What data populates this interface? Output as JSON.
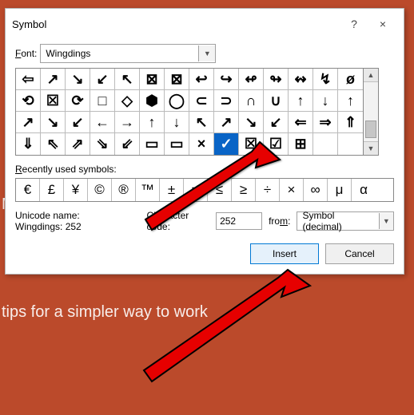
{
  "background": {
    "line1": "M",
    "line2": "tips for a simpler way to work"
  },
  "dialog": {
    "title": "Symbol",
    "help_icon": "?",
    "close_icon": "×",
    "font_label": "Font:",
    "font_value": "Wingdings",
    "grid_rows": [
      [
        "⇦",
        "↗",
        "↘",
        "↙",
        "↖",
        "⊠",
        "⊠",
        "↩",
        "↪",
        "↫",
        "↬",
        "↭",
        "↯",
        "ø"
      ],
      [
        "⟲",
        "☒",
        "⟳",
        "□",
        "◇",
        "⬢",
        "◯",
        "⊂",
        "⊃",
        "∩",
        "∪",
        "↑",
        "↓",
        "↑"
      ],
      [
        "↗",
        "↘",
        "↙",
        "←",
        "→",
        "↑",
        "↓",
        "↖",
        "↗",
        "↘",
        "↙",
        "⇐",
        "⇒",
        "⇑"
      ],
      [
        "⇓",
        "⇖",
        "⇗",
        "⇘",
        "⇙",
        "▭",
        "▭",
        "×",
        "✓",
        "☒",
        "☑",
        "⊞",
        "",
        ""
      ]
    ],
    "selected": {
      "row": 3,
      "col": 8
    },
    "recent_label": "Recently used symbols:",
    "recent_row": [
      "€",
      "£",
      "¥",
      "©",
      "®",
      "™",
      "±",
      "≠",
      "≤",
      "≥",
      "÷",
      "×",
      "∞",
      "μ",
      "α"
    ],
    "unicode_name_label": "Unicode name:",
    "unicode_name_value": "Wingdings: 252",
    "char_code_label": "Character code:",
    "char_code_value": "252",
    "from_label": "from:",
    "from_value": "Symbol (decimal)",
    "insert_button": "Insert",
    "cancel_button": "Cancel"
  }
}
